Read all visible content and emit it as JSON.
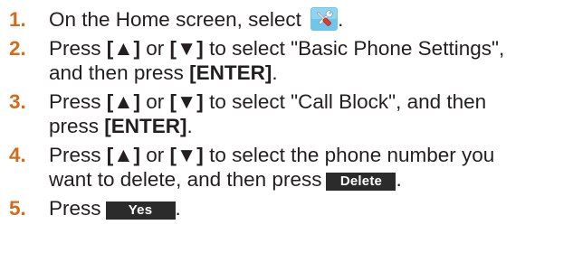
{
  "steps": [
    {
      "number": "1.",
      "text_before": "On the Home screen, select ",
      "icon": "settings-tools-icon",
      "text_after": "."
    },
    {
      "number": "2.",
      "line1_pre": "Press ",
      "key_up": "[▲]",
      "or": " or ",
      "key_down": "[▼]",
      "line1_post": " to select \"Basic Phone Settings\",",
      "line2_pre": "and then press ",
      "enter": "[ENTER]",
      "line2_post": "."
    },
    {
      "number": "3.",
      "line1_pre": "Press ",
      "key_up": "[▲]",
      "or": " or ",
      "key_down": "[▼]",
      "line1_post": " to select \"Call Block\", and then",
      "line2_pre": "press ",
      "enter": "[ENTER]",
      "line2_post": "."
    },
    {
      "number": "4.",
      "line1_pre": "Press ",
      "key_up": "[▲]",
      "or": " or ",
      "key_down": "[▼]",
      "line1_post": " to select the phone number you",
      "line2_pre": "want to delete, and then press",
      "softkey": "Delete",
      "line2_post": "."
    },
    {
      "number": "5.",
      "text_before": "Press",
      "softkey": "Yes",
      "text_after": "."
    }
  ],
  "colors": {
    "step_number": "#d36b1a",
    "text": "#231f20",
    "softkey_bg": "#2b2b2b",
    "icon_bg": "#6fc6ea"
  }
}
